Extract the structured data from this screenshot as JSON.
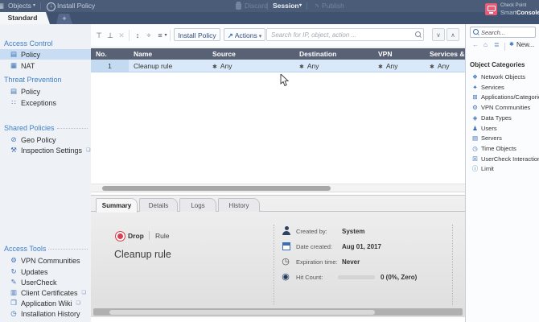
{
  "ui": {
    "caret": "▾"
  },
  "topbar": {
    "objects_icon": "▦",
    "objects": "Objects",
    "install_icon": "↓",
    "install_policy": "Install Policy",
    "discard": "Discard",
    "session": "Session",
    "publish": "Publish",
    "brand": {
      "line1": "Check Point",
      "line2_light": "Smart",
      "line2_bold": "Console"
    }
  },
  "tabstrip": {
    "active_tab": "Standard",
    "new_tab": "+"
  },
  "sidebar": {
    "sections": [
      {
        "title": "Access Control",
        "items": [
          {
            "label": "Policy",
            "icon": "▤"
          },
          {
            "label": "NAT",
            "icon": "▦"
          }
        ]
      },
      {
        "title": "Threat Prevention",
        "items": [
          {
            "label": "Policy",
            "icon": "▤"
          },
          {
            "label": "Exceptions",
            "icon": "∷"
          }
        ]
      },
      {
        "title": "Shared Policies",
        "items": [
          {
            "label": "Geo Policy",
            "icon": "⊘"
          },
          {
            "label": "Inspection Settings",
            "icon": "⚒",
            "external": "❏"
          }
        ]
      },
      {
        "title": "Access Tools",
        "items": [
          {
            "label": "VPN Communities",
            "icon": "⚙"
          },
          {
            "label": "Updates",
            "icon": "↻"
          },
          {
            "label": "UserCheck",
            "icon": "✎"
          },
          {
            "label": "Client Certificates",
            "icon": "▥",
            "external": "❏"
          },
          {
            "label": "Application Wiki",
            "icon": "❐",
            "external": "❏"
          },
          {
            "label": "Installation History",
            "icon": "◷"
          }
        ]
      }
    ]
  },
  "toolbar": {
    "icons": {
      "add_rule_top": "⊤",
      "add_rule_bottom": "⊥",
      "delete": "✕",
      "expand": "↕",
      "collapse": "÷",
      "view": "≡",
      "actions_arrow": "↗",
      "next": "∨",
      "prev": "∧"
    },
    "install_policy": "Install Policy",
    "actions": "Actions",
    "search_placeholder": "Search for IP, object, action ..."
  },
  "rulebase": {
    "columns": [
      "No.",
      "Name",
      "Source",
      "Destination",
      "VPN",
      "Services & Applications"
    ],
    "any_icon": "✱",
    "rows": [
      {
        "no": "1",
        "name": "Cleanup rule",
        "source": "Any",
        "destination": "Any",
        "vpn": "Any",
        "services": "Any"
      }
    ]
  },
  "details": {
    "tabs": [
      "Summary",
      "Details",
      "Logs",
      "History"
    ],
    "action": "Drop",
    "kind": "Rule",
    "rule_name": "Cleanup rule",
    "fields": [
      {
        "icon": "user",
        "label": "Created by:",
        "value": "System"
      },
      {
        "icon": "calendar",
        "label": "Date created:",
        "value": "Aug 01, 2017"
      },
      {
        "icon": "clock",
        "glyph": "◷",
        "label": "Expiration time:",
        "value": "Never"
      },
      {
        "icon": "hit-count",
        "glyph": "◉",
        "label": "Hit Count:",
        "value": "0 (0%, Zero)"
      }
    ]
  },
  "objects_panel": {
    "search_placeholder": "Search...",
    "back_icon": "←",
    "home_icon": "⌂",
    "list_icon": "≣",
    "new_icon": "✱",
    "new_label": "New...",
    "header": "Object Categories",
    "items": [
      {
        "label": "Network Objects",
        "icon": "❖"
      },
      {
        "label": "Services",
        "icon": "✦"
      },
      {
        "label": "Applications/Categories",
        "icon": "⊞"
      },
      {
        "label": "VPN Communities",
        "icon": "⚙"
      },
      {
        "label": "Data Types",
        "icon": "◈"
      },
      {
        "label": "Users",
        "icon": "♟"
      },
      {
        "label": "Servers",
        "icon": "▤"
      },
      {
        "label": "Time Objects",
        "icon": "◷"
      },
      {
        "label": "UserCheck Interactions",
        "icon": "☒"
      },
      {
        "label": "Limit",
        "icon": "ⓘ"
      }
    ]
  },
  "colors": {
    "topbar": "#4a5c78",
    "table_header": "#596275",
    "selected_row": "#d9e9f9",
    "accent_blue": "#3b6fb5",
    "drop_red": "#d8414f",
    "brand_pink": "#e85a75"
  }
}
